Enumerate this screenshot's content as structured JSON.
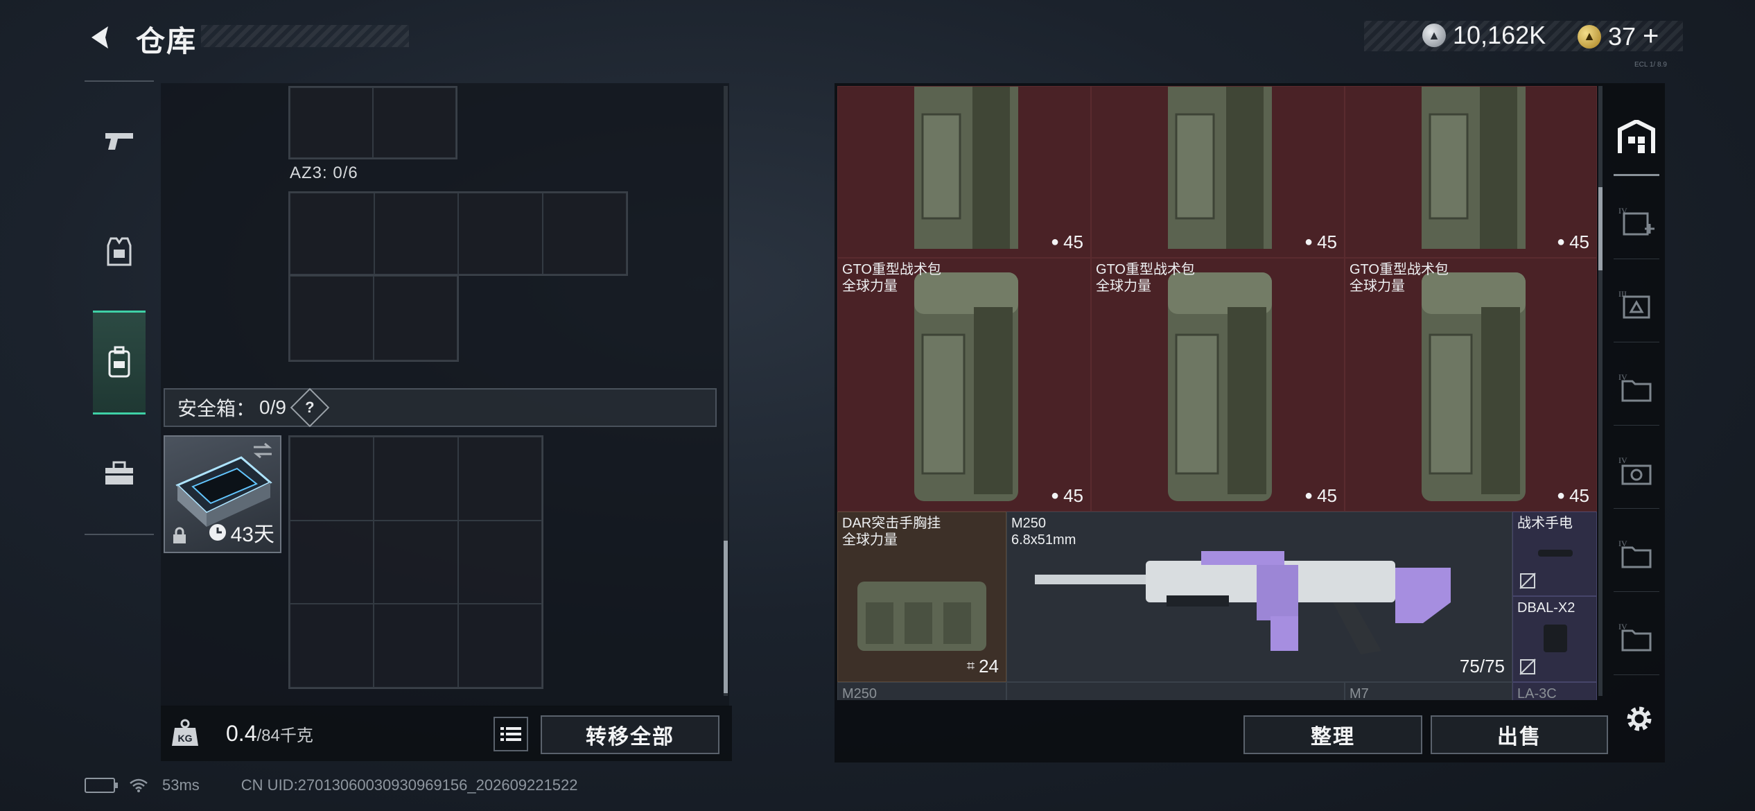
{
  "header": {
    "title": "仓库",
    "currencies": [
      {
        "icon": "silver-coin-icon",
        "value": "10,162K"
      },
      {
        "icon": "gold-coin-icon",
        "value": "37",
        "suffix": "+"
      }
    ],
    "tiny_code": "ECL 1/ 8.9"
  },
  "left_rail": {
    "items": [
      {
        "name": "weapons",
        "icon": "pistol-icon",
        "active": false
      },
      {
        "name": "equipment",
        "icon": "armor-vest-icon",
        "active": false
      },
      {
        "name": "backpack",
        "icon": "backpack-icon",
        "active": true
      },
      {
        "name": "toolbox",
        "icon": "toolbox-icon",
        "active": false
      }
    ]
  },
  "containers": {
    "az3_label": "AZ3: 0/6",
    "safe_box_label": "安全箱：",
    "safe_box_count": "0/9",
    "safe_box_help": "?",
    "safe_case_timer": "43天"
  },
  "footer_left": {
    "weight_value": "0.4",
    "weight_max": "/84千克",
    "transfer_all": "转移全部"
  },
  "inventory": {
    "tiles": [
      {
        "name": "",
        "brand": "",
        "count": "45"
      },
      {
        "name": "",
        "brand": "",
        "count": "45"
      },
      {
        "name": "",
        "brand": "",
        "count": "45"
      },
      {
        "name": "GTO重型战术包",
        "brand": "全球力量",
        "count": "45"
      },
      {
        "name": "GTO重型战术包",
        "brand": "全球力量",
        "count": "45"
      },
      {
        "name": "GTO重型战术包",
        "brand": "全球力量",
        "count": "45"
      },
      {
        "name": "DAR突击手胸挂",
        "brand": "全球力量",
        "count": "24"
      }
    ],
    "weapon": {
      "name": "M250",
      "caliber": "6.8x51mm",
      "ammo": "75/75"
    },
    "attachments": [
      {
        "name": "战术手电"
      },
      {
        "name": "DBAL-X2"
      }
    ],
    "partial_row": [
      "M250",
      "M7",
      "LA-3C"
    ]
  },
  "footer_right": {
    "sort": "整理",
    "sell": "出售"
  },
  "status_bar": {
    "ping": "53ms",
    "uid": "CN UID:27013060030930969156_202609221522"
  },
  "colors": {
    "accent": "#3fd1a6",
    "tile_red": "#4a2226",
    "tile_brown": "#3d3028",
    "tile_purple": "#2e2d45"
  }
}
